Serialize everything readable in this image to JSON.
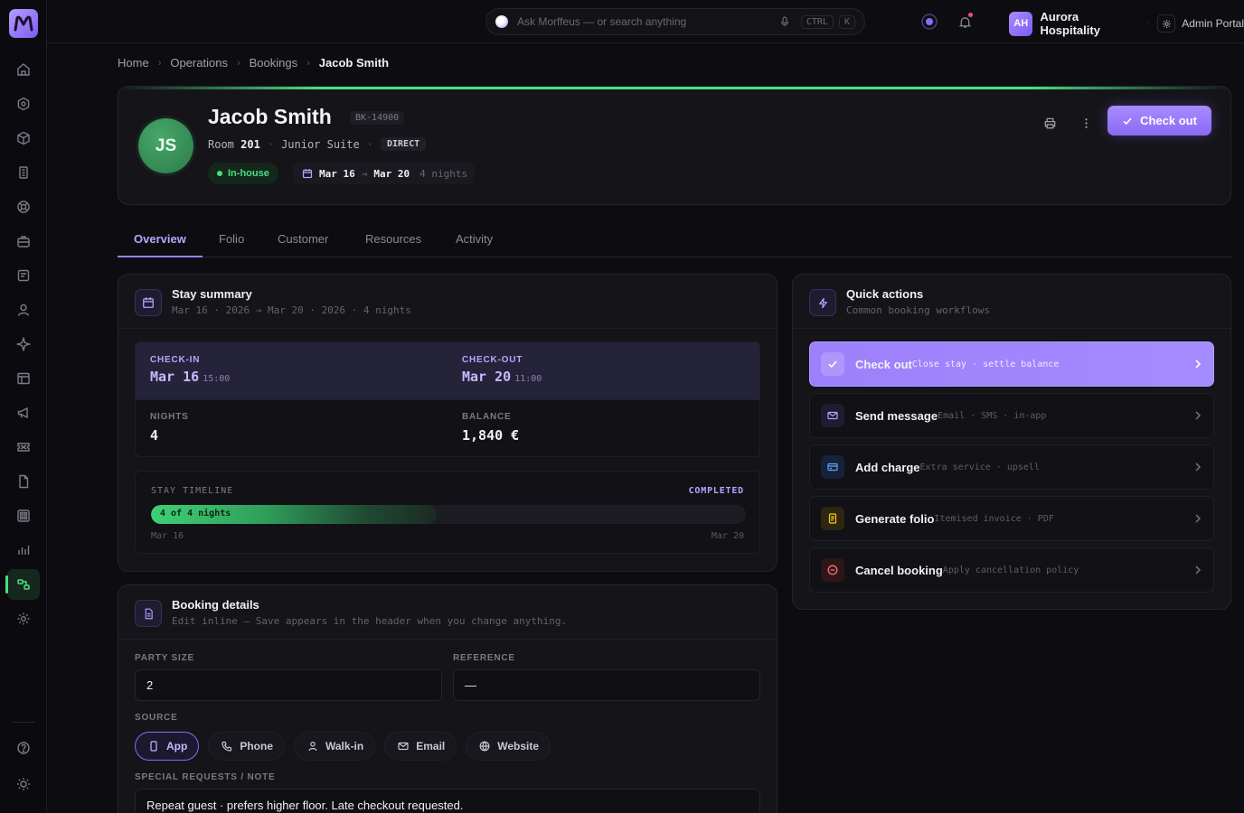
{
  "app": {
    "logo_letter": "m",
    "search_placeholder": "Ask Morffeus — or search anything",
    "search_kbd": [
      "CTRL",
      "K"
    ],
    "org_initials": "AH",
    "org_name": "Aurora Hospitality",
    "portal_label": "Admin Portal",
    "accent": "#9b7fff",
    "success": "#4ade80"
  },
  "breadcrumb": [
    "Home",
    "Operations",
    "Bookings",
    "Jacob Smith"
  ],
  "guest": {
    "initials": "JS",
    "name": "Jacob Smith",
    "booking_code": "BK-14900",
    "room_label": "Room",
    "room_number": "201",
    "room_type": "Junior Suite",
    "channel": "DIRECT",
    "status": "In-house",
    "date_from": "Mar 16",
    "date_arrow": "→",
    "date_to": "Mar 20",
    "nights_label": "4 nights",
    "checkout_label": "Check out"
  },
  "tabs": [
    "Overview",
    "Folio",
    "Customer",
    "Resources",
    "Activity"
  ],
  "stay": {
    "title": "Stay summary",
    "subtitle": "Mar 16 · 2026 → Mar 20 · 2026 · 4 nights",
    "checkin_label": "CHECK-IN",
    "checkin_date": "Mar 16",
    "checkin_time": "15:00",
    "checkout_label": "CHECK-OUT",
    "checkout_date": "Mar 20",
    "checkout_time": "11:00",
    "nights_label": "NIGHTS",
    "nights": "4",
    "balance_label": "BALANCE",
    "balance": "1,840 €",
    "timeline_label": "STAY TIMELINE",
    "timeline_status": "COMPLETED",
    "timeline_progress_text": "4 of 4 nights",
    "timeline_progress": 0.48,
    "timeline_start": "Mar 16",
    "timeline_end": "Mar 20"
  },
  "details": {
    "title": "Booking details",
    "subtitle": "Edit inline — Save appears in the header when you change anything.",
    "party_label": "PARTY SIZE",
    "party_value": "2",
    "reference_label": "REFERENCE",
    "reference_value": "—",
    "source_label": "SOURCE",
    "sources": [
      "App",
      "Phone",
      "Walk-in",
      "Email",
      "Website"
    ],
    "note_label": "SPECIAL REQUESTS / NOTE",
    "note_value": "Repeat guest · prefers higher floor. Late checkout requested."
  },
  "quick": {
    "title": "Quick actions",
    "subtitle": "Common booking workflows",
    "items": [
      {
        "title": "Check out",
        "sub": "Close stay · settle balance",
        "icon": "check-icon",
        "color": "#ffffff"
      },
      {
        "title": "Send message",
        "sub": "Email · SMS · in-app",
        "icon": "mail-icon",
        "color": "#b9a4ff"
      },
      {
        "title": "Add charge",
        "sub": "Extra service · upsell",
        "icon": "card-icon",
        "color": "#60a5fa"
      },
      {
        "title": "Generate folio",
        "sub": "Itemised invoice · PDF",
        "icon": "document-icon",
        "color": "#facc15"
      },
      {
        "title": "Cancel booking",
        "sub": "Apply cancellation policy",
        "icon": "cancel-icon",
        "color": "#f87171"
      }
    ]
  }
}
